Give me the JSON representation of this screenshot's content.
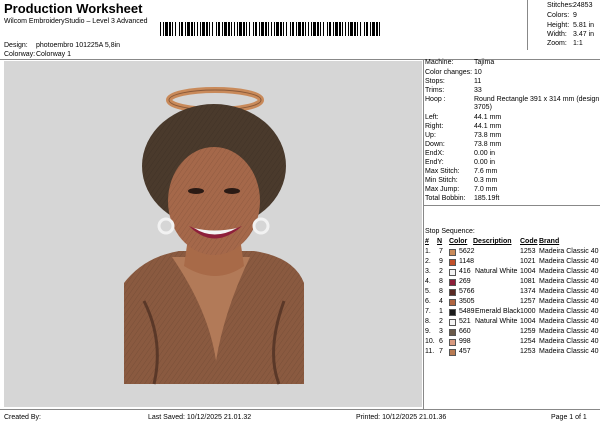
{
  "header": {
    "title": "Production Worksheet",
    "subtitle": "Wilcom EmbroideryStudio – Level 3 Advanced",
    "design_label": "Design:",
    "design_value": "photoembro 101225A 5,8in",
    "colorway_label": "Colorway:",
    "colorway_value": "Colorway 1"
  },
  "stats": [
    {
      "label": "Stitches:",
      "value": "24853"
    },
    {
      "label": "Colors:",
      "value": "9"
    },
    {
      "label": "Height:",
      "value": "5.81 in"
    },
    {
      "label": "Width:",
      "value": "3.47 in"
    },
    {
      "label": "Zoom:",
      "value": "1:1"
    }
  ],
  "machine_info": [
    {
      "label": "Machine:",
      "value": "Tajima"
    },
    {
      "label": "Color changes:",
      "value": "10"
    },
    {
      "label": "Stops:",
      "value": "11"
    },
    {
      "label": "Trims:",
      "value": "33"
    },
    {
      "label": "Hoop :",
      "value": "Round Rectangle 391 x 314 mm (design",
      "value2": "3705)"
    },
    {
      "label": "Left:",
      "value": "44.1 mm"
    },
    {
      "label": "Right:",
      "value": "44.1 mm"
    },
    {
      "label": "Up:",
      "value": "73.8 mm"
    },
    {
      "label": "Down:",
      "value": "73.8 mm"
    },
    {
      "label": "EndX:",
      "value": "0.00 in"
    },
    {
      "label": "EndY:",
      "value": "0.00 in"
    },
    {
      "label": "Max Stitch:",
      "value": "7.6 mm"
    },
    {
      "label": "Min Stitch:",
      "value": "0.3 mm"
    },
    {
      "label": "Max Jump:",
      "value": "7.0 mm"
    },
    {
      "label": "Total Bobbin:",
      "value": "185.19ft"
    }
  ],
  "stop_sequence": {
    "title": "Stop Sequence:",
    "headers": [
      "#",
      "N",
      "Color",
      "Description",
      "Code",
      "Brand"
    ],
    "rows": [
      {
        "num": "1.",
        "n": "7",
        "color": "#c98a5a",
        "code_num": "5622",
        "desc": "",
        "code": "1253",
        "brand": "Madeira Classic 40"
      },
      {
        "num": "2.",
        "n": "9",
        "color": "#c2502a",
        "code_num": "1148",
        "desc": "",
        "code": "1021",
        "brand": "Madeira Classic 40"
      },
      {
        "num": "3.",
        "n": "2",
        "color": "#f2f2f2",
        "code_num": "416",
        "desc": "Natural White",
        "code": "1004",
        "brand": "Madeira Classic 40"
      },
      {
        "num": "4.",
        "n": "8",
        "color": "#8e1f3a",
        "code_num": "269",
        "desc": "",
        "code": "1081",
        "brand": "Madeira Classic 40"
      },
      {
        "num": "5.",
        "n": "8",
        "color": "#5a2a24",
        "code_num": "5766",
        "desc": "",
        "code": "1374",
        "brand": "Madeira Classic 40"
      },
      {
        "num": "6.",
        "n": "4",
        "color": "#b06440",
        "code_num": "3505",
        "desc": "",
        "code": "1257",
        "brand": "Madeira Classic 40"
      },
      {
        "num": "7.",
        "n": "1",
        "color": "#1c1c1c",
        "code_num": "5489",
        "desc": "Emerald Black",
        "code": "1000",
        "brand": "Madeira Classic 40"
      },
      {
        "num": "8.",
        "n": "2",
        "color": "#f4f4f4",
        "code_num": "521",
        "desc": "Natural White",
        "code": "1004",
        "brand": "Madeira Classic 40"
      },
      {
        "num": "9.",
        "n": "3",
        "color": "#6b5a4a",
        "code_num": "660",
        "desc": "",
        "code": "1259",
        "brand": "Madeira Classic 40"
      },
      {
        "num": "10.",
        "n": "6",
        "color": "#d89a80",
        "code_num": "998",
        "desc": "",
        "code": "1254",
        "brand": "Madeira Classic 40"
      },
      {
        "num": "11.",
        "n": "7",
        "color": "#b87a52",
        "code_num": "457",
        "desc": "",
        "code": "1253",
        "brand": "Madeira Classic 40"
      }
    ]
  },
  "footer": {
    "created_by": "Created By:",
    "last_saved": "Last Saved: 10/12/2025 21.01.32",
    "printed": "Printed: 10/12/2025 21.01.36",
    "page": "Page 1 of 1"
  }
}
